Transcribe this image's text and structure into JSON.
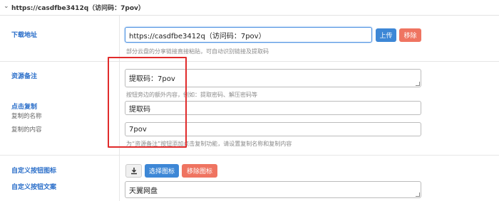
{
  "header": {
    "title": "https://casdfbe3412q（访问码：7pov）"
  },
  "download": {
    "label": "下载地址",
    "value": "https://casdfbe3412q（访问码：7pov）",
    "upload_label": "上传",
    "remove_label": "移除",
    "help": "部分云盘的分享链接直接粘贴，可自动识别链接及提取码"
  },
  "note": {
    "label": "资源备注",
    "value": "提取码：7pov",
    "help": "按钮旁边的额外内容，例如：提取密码、解压密码等"
  },
  "copy": {
    "label": "点击复制",
    "name_label": "复制的名称",
    "content_label": "复制的内容",
    "name_value": "提取码",
    "content_value": "7pov",
    "help": "为“资源备注”按钮添加点击复制功能，请设置复制名称和复制内容"
  },
  "custom_icon": {
    "label": "自定义按钮图标",
    "select_label": "选择图标",
    "remove_label": "移除图标"
  },
  "custom_text": {
    "label": "自定义按钮文案",
    "value": "天翼网盘"
  },
  "colors": {
    "accent": "#3d87d6",
    "danger": "#ef7461",
    "label": "#2a6ec9",
    "highlight": "#e02b2b"
  }
}
